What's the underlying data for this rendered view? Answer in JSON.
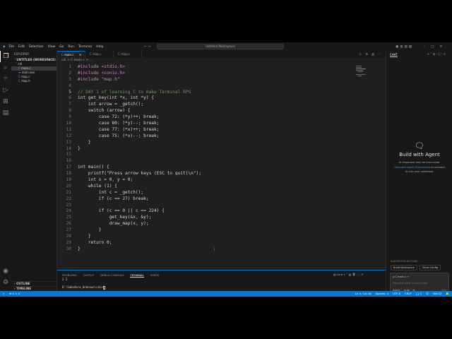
{
  "menu": [
    "File",
    "Edit",
    "Selection",
    "View",
    "Go",
    "Run",
    "Terminal",
    "Help"
  ],
  "search": "Untitled (Workspace)",
  "sidebar": {
    "title": "EXPLORER",
    "workspace": "UNTITLED (WORKSPACE)",
    "folder": "cdi",
    "files": [
      "main.c",
      "main.exe",
      "map.c",
      "map.h"
    ],
    "outline": "OUTLINE",
    "timeline": "TIMELINE"
  },
  "tabs": [
    "main.c",
    "map.c",
    "map.h"
  ],
  "breadcrumb": "cdi > C main.c > ...",
  "code": [
    "#include <stdio.h>",
    "#include <conio.h>",
    "#include \"map.h\"",
    "",
    "// DAY 1 of learning C to make Terminal RPG",
    "int get_key(int *x, int *y) {",
    "    int arrow = _getch();",
    "    switch (arrow) {",
    "        case 72: (*y)++; break;",
    "        case 80: (*y)--; break;",
    "        case 77: (*x)++; break;",
    "        case 75: (*x)--; break;",
    "    }",
    "}",
    "",
    "",
    "int main() {",
    "    printf(\"Press arrow keys (ESC to quit)\\n\");",
    "    int x = 0, y = 0;",
    "    while (1) {",
    "        int c = _getch();",
    "        if (c == 27) break;",
    "",
    "        if (c == 0 || c == 224) {",
    "            get_key(&x, &y);",
    "            draw_map(x, y);",
    "        }",
    "    }",
    "    return 0;",
    "}"
  ],
  "chat": {
    "tab": "CHAT",
    "title": "Build with Agent",
    "line1": "AI responses may be inaccurate.",
    "link": "Generate Agent Instructions",
    "line2": "to onboard",
    "line3": "AI into your codebase.",
    "suggested": "SUGGESTED ACTIONS",
    "actions": [
      "Build Workspace",
      "Show Config"
    ],
    "context": "C main.c",
    "placeholder": "Describe what to build next",
    "mode": "Agent",
    "model": "Auto"
  },
  "panel": {
    "tabs": [
      "PROBLEMS",
      "OUTPUT",
      "DEBUG CONSOLE",
      "TERMINAL",
      "PORTS"
    ],
    "active": 3,
    "line1": "2 2",
    "prompt": "D:\\Sabedara_Unknown\\cdi>",
    "shell": "cmd"
  },
  "status": {
    "left": "⊗ 0 ⚠ 0",
    "items": [
      "Ln 5, Col 44",
      "Spaces: 4",
      "UTF-8",
      "CRLF",
      "{} C",
      "Win32"
    ]
  }
}
